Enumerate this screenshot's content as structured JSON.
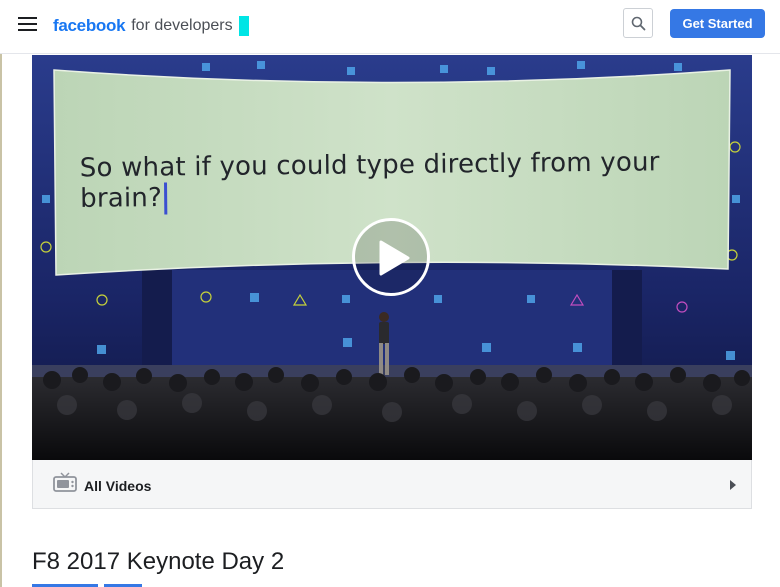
{
  "header": {
    "logo_brand": "facebook",
    "logo_suffix": "for developers",
    "cta_label": "Get Started"
  },
  "icons": {
    "menu": "hamburger-menu-icon",
    "search": "search-icon",
    "play": "play-icon",
    "videos": "tv-icon",
    "expand": "caret-right-icon"
  },
  "video": {
    "screen_caption": "So what if you could type directly from your brain?"
  },
  "video_footer": {
    "label": "All Videos"
  },
  "main": {
    "title": "F8 2017 Keynote Day 2"
  },
  "colors": {
    "brand": "#1877f2",
    "cta": "#3578e5",
    "cursor_highlight": "#00e5e5",
    "stage": "#1c2966",
    "screen": "#c5dcbf"
  }
}
